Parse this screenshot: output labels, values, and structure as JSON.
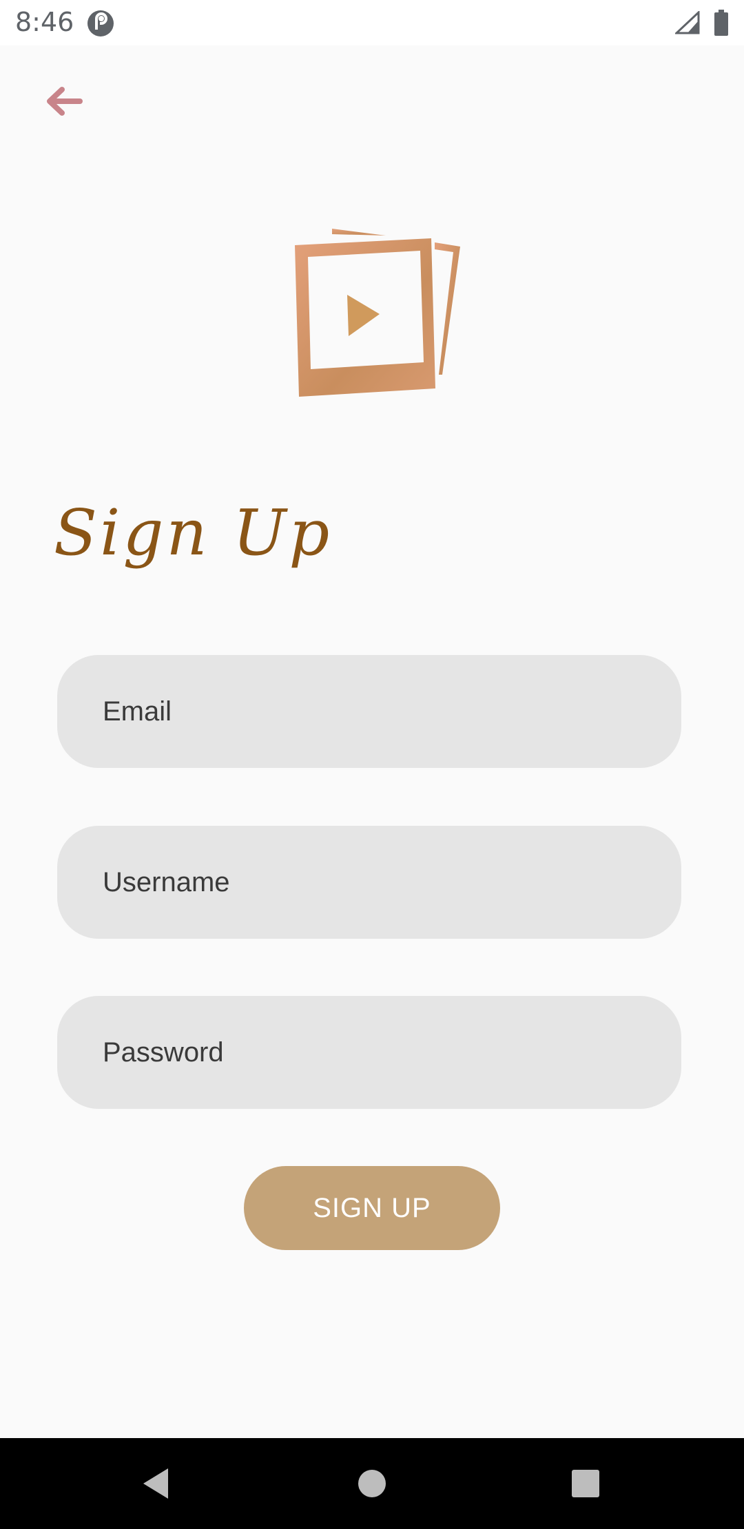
{
  "status_bar": {
    "time": "8:46",
    "app_icon": "pocket-casts-icon",
    "signal_icon": "cell-signal-icon",
    "battery_icon": "battery-icon"
  },
  "header": {
    "back_icon": "arrow-left-icon",
    "back_color": "#c8848a"
  },
  "logo": {
    "icon": "photo-play-logo",
    "color": "#d9956a"
  },
  "form": {
    "title": "Sign Up",
    "title_color": "#8a5516",
    "email_placeholder": "Email",
    "username_placeholder": "Username",
    "password_placeholder": "Password",
    "submit_label": "SIGN UP",
    "submit_color": "#c4a378",
    "field_color": "#e5e5e5"
  },
  "nav_bar": {
    "back_icon": "triangle-back-icon",
    "home_icon": "circle-home-icon",
    "recents_icon": "square-recents-icon"
  }
}
